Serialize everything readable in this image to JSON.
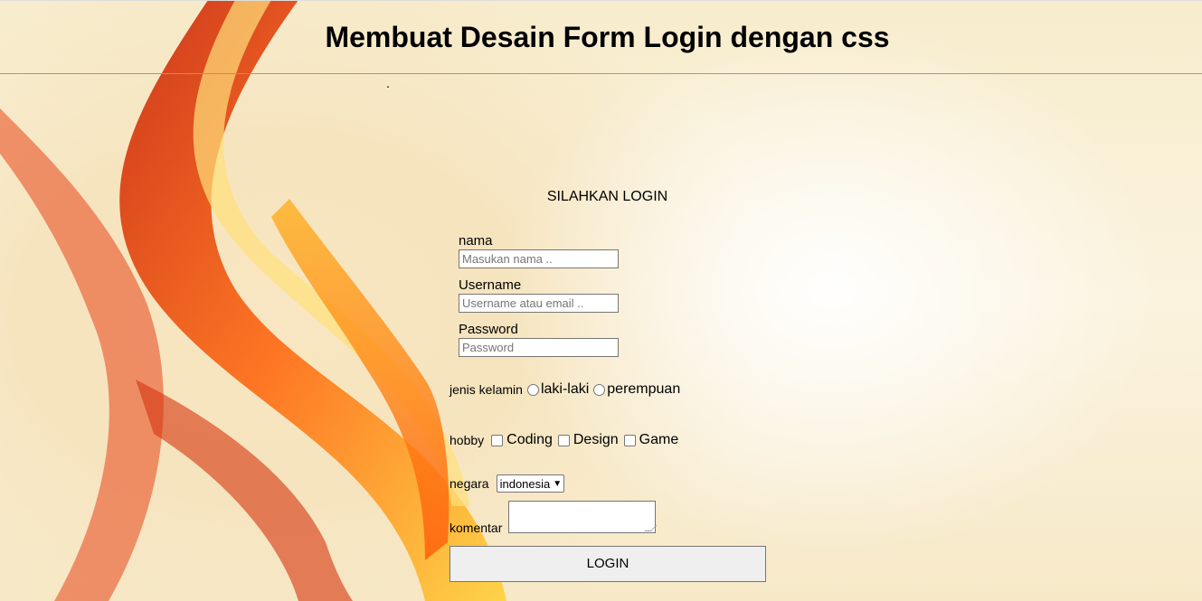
{
  "header": {
    "title": "Membuat Desain Form Login dengan css",
    "dot": "."
  },
  "form": {
    "title": "SILAHKAN LOGIN",
    "nama": {
      "label": "nama",
      "placeholder": "Masukan nama .."
    },
    "username": {
      "label": "Username",
      "placeholder": "Username atau email .."
    },
    "password": {
      "label": "Password",
      "placeholder": "Password"
    },
    "gender": {
      "label": "jenis kelamin",
      "options": [
        "laki-laki",
        "perempuan"
      ]
    },
    "hobby": {
      "label": "hobby",
      "options": [
        "Coding",
        "Design",
        "Game"
      ]
    },
    "country": {
      "label": "negara",
      "selected": "indonesia"
    },
    "comment": {
      "label": "komentar",
      "value": ""
    },
    "submit_label": "LOGIN"
  },
  "icons": {
    "select_arrow": "chevron-down-icon"
  }
}
